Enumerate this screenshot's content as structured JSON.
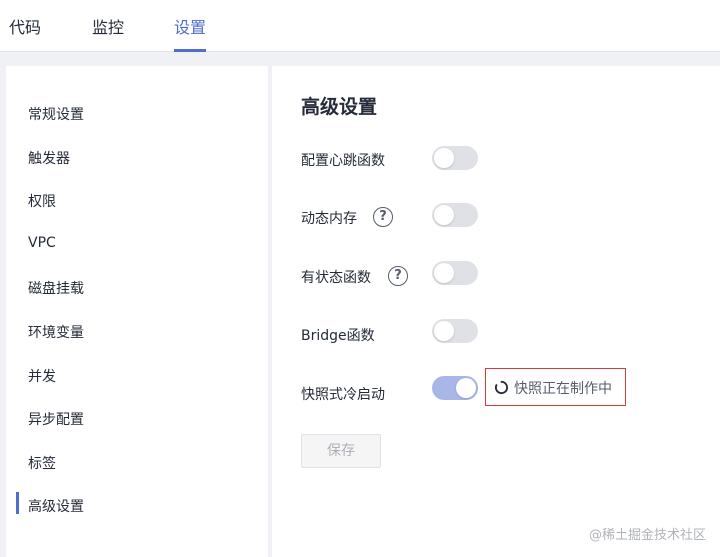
{
  "tabs": [
    {
      "label": "代码"
    },
    {
      "label": "监控"
    },
    {
      "label": "设置"
    }
  ],
  "sidebar": {
    "items": [
      {
        "label": "常规设置"
      },
      {
        "label": "触发器"
      },
      {
        "label": "权限"
      },
      {
        "label": "VPC"
      },
      {
        "label": "磁盘挂载"
      },
      {
        "label": "环境变量"
      },
      {
        "label": "并发"
      },
      {
        "label": "异步配置"
      },
      {
        "label": "标签"
      },
      {
        "label": "高级设置"
      }
    ],
    "active": "高级设置"
  },
  "main": {
    "title": "高级设置",
    "settings": [
      {
        "label": "配置心跳函数",
        "enabled": false
      },
      {
        "label": "动态内存",
        "enabled": false,
        "help": "?"
      },
      {
        "label": "有状态函数",
        "enabled": false,
        "help": "?"
      },
      {
        "label": "Bridge函数",
        "enabled": false
      },
      {
        "label": "快照式冷启动",
        "enabled": true
      }
    ],
    "snapshot_status": "快照正在制作中",
    "save_label": "保存"
  },
  "watermark": "@稀土掘金技术社区",
  "colors": {
    "accent": "#526ecc",
    "switch_on": "#a8b7e8",
    "switch_off": "#dfe1e6",
    "highlight_border": "#d63c3c"
  }
}
